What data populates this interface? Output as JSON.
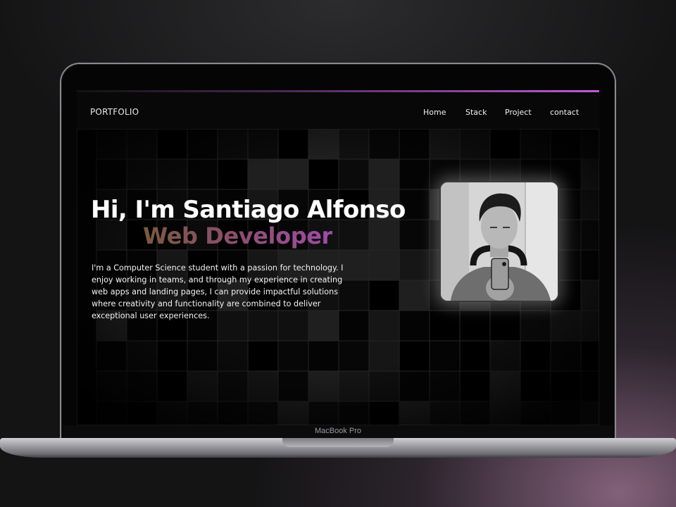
{
  "device": {
    "label": "MacBook Pro"
  },
  "site": {
    "brand": "PORTFOLIO",
    "accent_color": "#c35ad8",
    "nav": [
      {
        "label": "Home"
      },
      {
        "label": "Stack"
      },
      {
        "label": "Project"
      },
      {
        "label": "contact"
      }
    ]
  },
  "hero": {
    "title": "Hi, I'm Santiago Alfonso",
    "subtitle": "Web Developer",
    "subtitle_gradient": [
      "#7a5a3e",
      "#8a4f6a",
      "#a24ba8"
    ],
    "description": "I'm a Computer Science student with a passion for technology. I enjoy working in teams, and through my experience in creating web apps and landing pages, I can provide impactful solutions where creativity and functionality are combined to deliver exceptional user experiences."
  },
  "profile_photo": {
    "style": "grayscale mirror selfie with headphones"
  }
}
